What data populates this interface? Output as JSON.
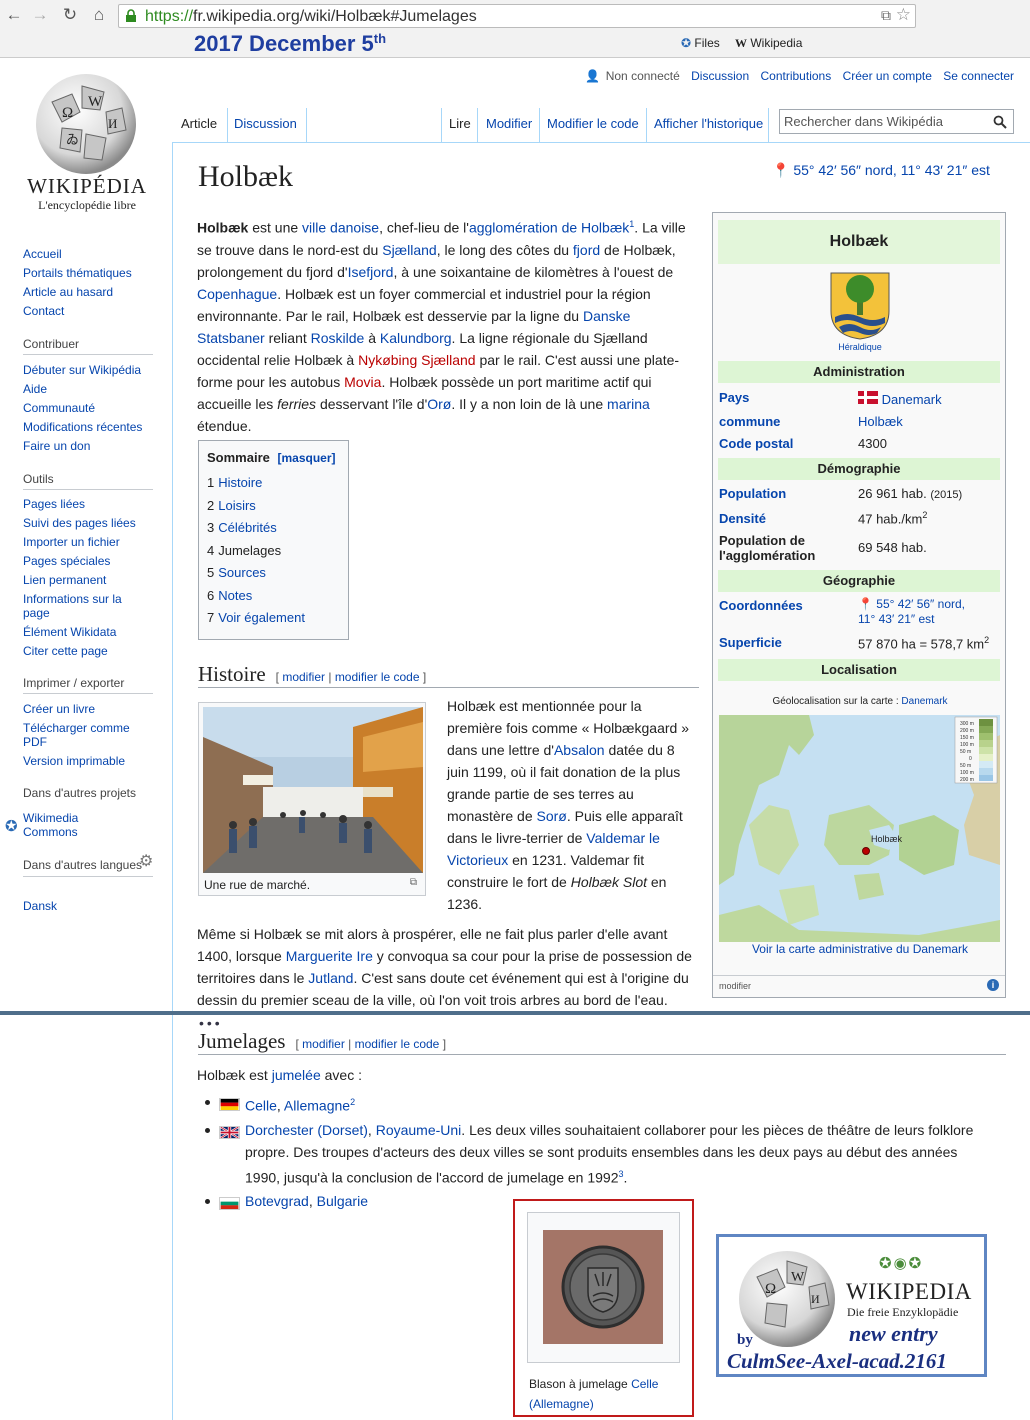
{
  "browser": {
    "url_proto": "https://",
    "url_rest": "fr.wikipedia.org/wiki/Holbæk#Jumelages",
    "bookmarks": [
      "Files",
      "Wikipedia"
    ]
  },
  "annotation": {
    "date_main": "2017 December 5",
    "date_sup": "th"
  },
  "logo": {
    "wordmark": "WIKIPÉDIA",
    "tagline": "L'encyclopédie libre"
  },
  "sidebar": {
    "nav": [
      "Accueil",
      "Portails thématiques",
      "Article au hasard",
      "Contact"
    ],
    "contribuer_title": "Contribuer",
    "contribuer": [
      "Débuter sur Wikipédia",
      "Aide",
      "Communauté",
      "Modifications récentes",
      "Faire un don"
    ],
    "outils_title": "Outils",
    "outils": [
      "Pages liées",
      "Suivi des pages liées",
      "Importer un fichier",
      "Pages spéciales",
      "Lien permanent",
      "Informations sur la page",
      "Élément Wikidata",
      "Citer cette page"
    ],
    "imprimer_title": "Imprimer / exporter",
    "imprimer": [
      "Créer un livre",
      "Télécharger comme PDF",
      "Version imprimable"
    ],
    "projets_title": "Dans d'autres projets",
    "projets": [
      "Wikimedia Commons"
    ],
    "langues_title": "Dans d'autres langues",
    "langues": [
      "Dansk"
    ]
  },
  "toplinks": [
    "Non connecté",
    "Discussion",
    "Contributions",
    "Créer un compte",
    "Se connecter"
  ],
  "tabs": {
    "left": [
      "Article",
      "Discussion"
    ],
    "right": [
      "Lire",
      "Modifier",
      "Modifier le code",
      "Afficher l'historique"
    ]
  },
  "search": {
    "placeholder": "Rechercher dans Wikipédia"
  },
  "article": {
    "title": "Holbæk",
    "coord": "55° 42′ 56″ nord, 11° 43′ 21″ est"
  },
  "toc": {
    "title": "Sommaire",
    "toggle": "[masquer]",
    "items": [
      {
        "num": "1",
        "label": "Histoire"
      },
      {
        "num": "2",
        "label": "Loisirs"
      },
      {
        "num": "3",
        "label": "Célébrités"
      },
      {
        "num": "4",
        "label": "Jumelages"
      },
      {
        "num": "5",
        "label": "Sources"
      },
      {
        "num": "6",
        "label": "Notes"
      },
      {
        "num": "7",
        "label": "Voir également"
      }
    ]
  },
  "sections": {
    "histoire": "Histoire",
    "jumelages": "Jumelages",
    "edit": "modifier",
    "edit_code": "modifier le code"
  },
  "hist_caption": "Une rue de marché.",
  "infobox": {
    "title": "Holbæk",
    "heraldique": "Héraldique",
    "h_admin": "Administration",
    "pays_l": "Pays",
    "pays_v": "Danemark",
    "commune_l": "commune",
    "commune_v": "Holbæk",
    "cp_l": "Code postal",
    "cp_v": "4300",
    "h_demo": "Démographie",
    "pop_l": "Population",
    "pop_v": "26 961 hab.",
    "pop_y": "(2015)",
    "dens_l": "Densité",
    "dens_v": "47 hab./km",
    "aggl_l1": "Population de",
    "aggl_l2": "l'agglomération",
    "aggl_v": "69 548 hab.",
    "h_geo": "Géographie",
    "coord_l": "Coordonnées",
    "coord_v1": "55° 42′ 56″ nord,",
    "coord_v2": "11° 43′ 21″ est",
    "sup_l": "Superficie",
    "sup_v": "57 870 ha = 578,7 km",
    "h_loc": "Localisation",
    "geo_label": "Géolocalisation sur la carte :",
    "geo_link": "Danemark",
    "map_city": "Holbæk",
    "map_link": "Voir la carte administrative du Danemark",
    "legend": [
      "300 m",
      "200 m",
      "150 m",
      "100 m",
      "50 m",
      "0",
      "50 m",
      "100 m",
      "200 m"
    ],
    "footer": "modifier"
  },
  "jumelages": {
    "lead_a": "Holbæk est",
    "lead_link": "jumelée",
    "lead_b": "avec :",
    "items": [
      {
        "city": "Celle",
        "country": "Allemagne",
        "ref": "2",
        "rest": ""
      },
      {
        "city": "Dorchester (Dorset)",
        "country": "Royaume-Uni",
        "ref": "3",
        "rest": ". Les deux villes souhaitaient collaborer pour les pièces de théâtre de leurs folklore propre. Des troupes d'acteurs des deux villes se sont produits ensembles dans les deux pays au début des années 1990, jusqu'à la conclusion de l'accord de jumelage en 1992"
      },
      {
        "city": "Botevgrad",
        "country": "Bulgarie",
        "ref": "",
        "rest": ""
      }
    ],
    "caption_a": "Blason à jumelage",
    "caption_link": "Celle (Allemagne)"
  },
  "badge": {
    "word": "WIKIPEDIA",
    "tag": "Die freie Enzyklopädie",
    "by": "by",
    "new_entry": "new entry",
    "author": "CulmSee-Axel-acad.2161"
  },
  "colors": {
    "link": "#0645ad",
    "redlink": "#ba0000",
    "header_green": "#ddf5d4",
    "annotation_blue": "#1f3ea0"
  }
}
